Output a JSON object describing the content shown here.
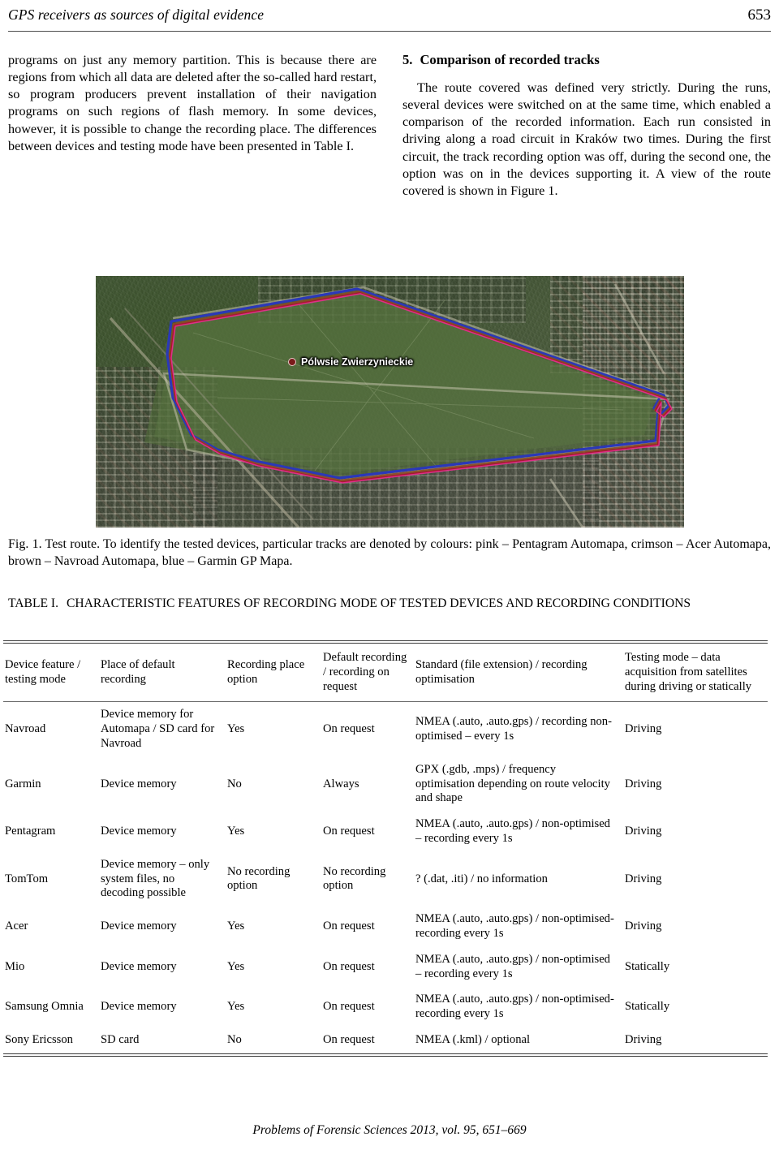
{
  "header": {
    "running_title": "GPS receivers as sources of digital evidence",
    "page_number": "653"
  },
  "left_column": {
    "paragraph": "programs on just any memory partition. This is because there are regions from which all data are deleted after the so-called hard restart, so program producers prevent installation of their navigation programs on such regions of flash memory. In some devices, however, it is possible to change the recording place. The differences between devices and testing mode have been presented in Table I."
  },
  "right_column": {
    "section_number": "5.",
    "section_title": "Comparison of recorded tracks",
    "paragraph": "The route covered was defined very strictly. During the runs, several devices were switched on at the same time, which enabled a comparison of the recorded information. Each run consisted in driving along a road circuit in Kraków two times. During the first circuit, the track recording option was off, during the second one, the option was on in the devices supporting it. A view of the route covered is shown in Figure 1."
  },
  "figure": {
    "map_label": "Pólwsie Zwierzynieckie",
    "caption": "Fig. 1. Test route. To identify the tested devices, particular tracks are denoted by colours: pink – Pentagram Automapa, crimson – Acer Automapa, brown – Navroad Automapa, blue – Garmin GP Mapa.",
    "track_colors": {
      "pink_pentagram": "#e0328c",
      "crimson_acer": "#b01030",
      "brown_navroad": "#8a4a22",
      "blue_garmin": "#2b38b8"
    }
  },
  "table": {
    "label": "TABLE I.",
    "title": "CHARACTERISTIC FEATURES OF RECORDING MODE OF TESTED DEVICES AND RECORDING CONDITIONS",
    "columns": [
      "Device feature / testing mode",
      "Place of default recording",
      "Recording place option",
      "Default recording / recording on request",
      "Standard (file extension) / recording optimisation",
      "Testing mode – data acquisition from satellites during driving or statically"
    ],
    "rows": [
      {
        "device": "Navroad",
        "place": "Device memory for Automapa / SD card for Navroad",
        "place_option": "Yes",
        "default_recording": "On request",
        "standard": "NMEA (.auto, .auto.gps) / recording non-optimised – every 1s",
        "testing_mode": "Driving"
      },
      {
        "device": "Garmin",
        "place": "Device memory",
        "place_option": "No",
        "default_recording": "Always",
        "standard": "GPX (.gdb, .mps) / frequency optimisation depending on route velocity and shape",
        "testing_mode": "Driving"
      },
      {
        "device": "Pentagram",
        "place": "Device memory",
        "place_option": "Yes",
        "default_recording": "On request",
        "standard": "NMEA (.auto, .auto.gps) / non-optimised – recording every 1s",
        "testing_mode": "Driving"
      },
      {
        "device": "TomTom",
        "place": "Device memory – only system files, no decoding possible",
        "place_option": "No recording option",
        "default_recording": "No recording option",
        "standard": "? (.dat, .iti) / no information",
        "testing_mode": "Driving"
      },
      {
        "device": "Acer",
        "place": "Device memory",
        "place_option": "Yes",
        "default_recording": "On request",
        "standard": "NMEA (.auto, .auto.gps) / non-optimised- recording every 1s",
        "testing_mode": "Driving"
      },
      {
        "device": "Mio",
        "place": "Device memory",
        "place_option": "Yes",
        "default_recording": "On request",
        "standard": "NMEA (.auto, .auto.gps) / non-optimised – recording every 1s",
        "testing_mode": "Statically"
      },
      {
        "device": "Samsung Omnia",
        "place": "Device memory",
        "place_option": "Yes",
        "default_recording": "On request",
        "standard": "NMEA (.auto, .auto.gps) / non-optimised- recording every 1s",
        "testing_mode": "Statically"
      },
      {
        "device": "Sony Ericsson",
        "place": "SD card",
        "place_option": "No",
        "default_recording": "On request",
        "standard": "NMEA (.kml) / optional",
        "testing_mode": "Driving"
      }
    ]
  },
  "footer": {
    "text": "Problems of Forensic Sciences 2013, vol. 95, 651–669"
  }
}
